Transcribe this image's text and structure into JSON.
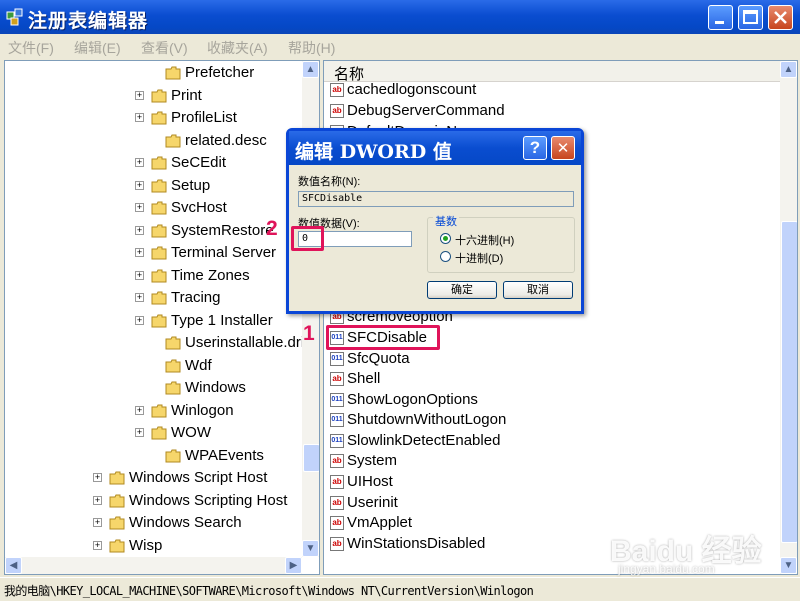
{
  "window": {
    "title": "注册表编辑器"
  },
  "menu": [
    "文件(F)",
    "编辑(E)",
    "查看(V)",
    "收藏夹(A)",
    "帮助(H)"
  ],
  "tree": [
    {
      "label": "Prefetcher",
      "exp": ""
    },
    {
      "label": "Print",
      "exp": "+"
    },
    {
      "label": "ProfileList",
      "exp": "+"
    },
    {
      "label": "related.desc",
      "exp": ""
    },
    {
      "label": "SeCEdit",
      "exp": "+"
    },
    {
      "label": "Setup",
      "exp": "+"
    },
    {
      "label": "SvcHost",
      "exp": "+"
    },
    {
      "label": "SystemRestore",
      "exp": "+"
    },
    {
      "label": "Terminal Server",
      "exp": "+"
    },
    {
      "label": "Time Zones",
      "exp": "+"
    },
    {
      "label": "Tracing",
      "exp": "+"
    },
    {
      "label": "Type 1 Installer",
      "exp": "+"
    },
    {
      "label": "Userinstallable.drivers",
      "exp": ""
    },
    {
      "label": "Wdf",
      "exp": ""
    },
    {
      "label": "Windows",
      "exp": ""
    },
    {
      "label": "Winlogon",
      "exp": "+"
    },
    {
      "label": "WOW",
      "exp": "+"
    },
    {
      "label": "WPAEvents",
      "exp": ""
    },
    {
      "label": "Windows Script Host",
      "exp": "+"
    },
    {
      "label": "Windows Scripting Host",
      "exp": "+"
    },
    {
      "label": "Windows Search",
      "exp": "+"
    },
    {
      "label": "Wisp",
      "exp": "+"
    }
  ],
  "list": {
    "header": "名称",
    "values": [
      {
        "name": "cachedlogonscount",
        "type": "sz"
      },
      {
        "name": "DebugServerCommand",
        "type": "sz"
      },
      {
        "name": "DefaultDomainName",
        "type": "sz"
      },
      {
        "name": "scremoveoption",
        "type": "sz"
      },
      {
        "name": "SFCDisable",
        "type": "bin"
      },
      {
        "name": "SfcQuota",
        "type": "bin"
      },
      {
        "name": "Shell",
        "type": "sz"
      },
      {
        "name": "ShowLogonOptions",
        "type": "bin"
      },
      {
        "name": "ShutdownWithoutLogon",
        "type": "bin"
      },
      {
        "name": "SlowlinkDetectEnabled",
        "type": "bin"
      },
      {
        "name": "System",
        "type": "sz"
      },
      {
        "name": "UIHost",
        "type": "sz"
      },
      {
        "name": "Userinit",
        "type": "sz"
      },
      {
        "name": "VmApplet",
        "type": "sz"
      },
      {
        "name": "WinStationsDisabled",
        "type": "sz"
      }
    ]
  },
  "icons": {
    "string": "ab",
    "binary": "011"
  },
  "dialog": {
    "title": "编辑 DWORD 值",
    "value_name_label": "数值名称(N):",
    "value_name": "SFCDisable",
    "value_data_label": "数值数据(V):",
    "value_data": "0",
    "base_label": "基数",
    "hex_label": "十六进制(H)",
    "dec_label": "十进制(D)",
    "ok_label": "确定",
    "cancel_label": "取消",
    "help_glyph": "?",
    "close_glyph": "✕"
  },
  "annotations": {
    "step1": "1",
    "step2": "2"
  },
  "statusbar": "我的电脑\\HKEY_LOCAL_MACHINE\\SOFTWARE\\Microsoft\\Windows NT\\CurrentVersion\\Winlogon",
  "watermark": {
    "brand": "Baidu 经验",
    "url": "jingyan.baidu.com"
  },
  "colors": {
    "titlebar": "#0A4DD0",
    "highlight": "#E0145A",
    "face": "#ECE9D8"
  }
}
